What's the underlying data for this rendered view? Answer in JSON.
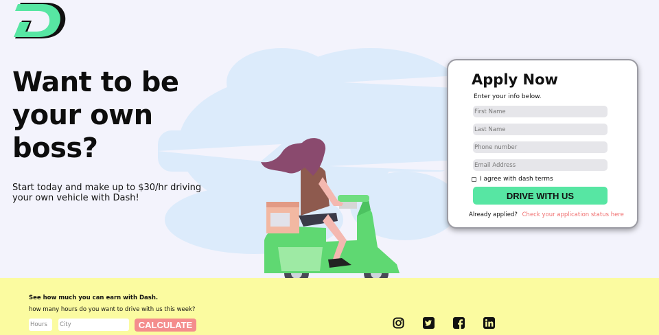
{
  "brand": {
    "logo": "dash-logo",
    "accent": "#57e6a3",
    "link_color": "#f07070"
  },
  "hero": {
    "title": "Want to be your own boss?",
    "subtitle": "Start today and make up to $30/hr driving your own vehicle with Dash!"
  },
  "apply": {
    "title": "Apply Now",
    "subtitle": "Enter your info below.",
    "fields": [
      {
        "placeholder": "First Name",
        "value": ""
      },
      {
        "placeholder": "Last Name",
        "value": ""
      },
      {
        "placeholder": "Phone number",
        "value": ""
      },
      {
        "placeholder": "Email Address",
        "value": ""
      }
    ],
    "terms_label": "I agree with dash terms",
    "terms_checked": false,
    "submit_label": "DRIVE WITH US",
    "already_applied": "Already applied?",
    "status_link": "Check your application status here"
  },
  "earnings": {
    "title": "See how much you can earn with Dash.",
    "question": "how many hours do you want to drive with us this week?",
    "hours_placeholder": "Hours",
    "city_placeholder": "City",
    "calculate_label": "CALCULATE",
    "background": "#fbfba0",
    "button_color": "#f48d8d"
  },
  "social": [
    "instagram-icon",
    "twitter-icon",
    "facebook-icon",
    "linkedin-icon"
  ]
}
